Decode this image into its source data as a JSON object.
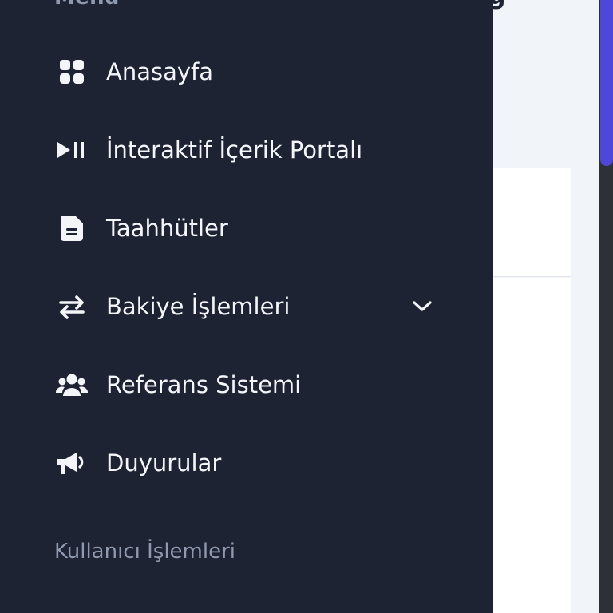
{
  "background": {
    "title_fragment": "g"
  },
  "drawer": {
    "heading": "Menü",
    "items": [
      {
        "label": "Anasayfa",
        "icon": "grid-icon"
      },
      {
        "label": "İnteraktif İçerik Portalı",
        "icon": "play-pause-icon"
      },
      {
        "label": "Taahhütler",
        "icon": "document-icon"
      },
      {
        "label": "Bakiye İşlemleri",
        "icon": "transfer-arrows-icon",
        "expandable": true
      },
      {
        "label": "Referans Sistemi",
        "icon": "users-icon"
      },
      {
        "label": "Duyurular",
        "icon": "megaphone-icon"
      }
    ],
    "section_label": "Kullanıcı İşlemleri"
  },
  "colors": {
    "drawer_bg": "#1e2334",
    "text": "#f3f5f9",
    "muted_text": "#8f99b0",
    "accent": "#4f47d9"
  }
}
